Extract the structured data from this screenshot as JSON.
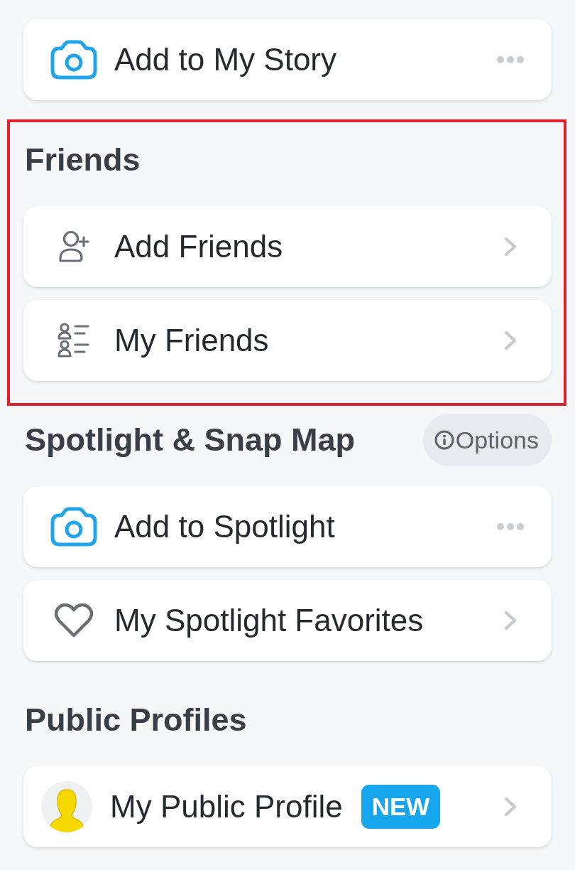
{
  "story_card": {
    "label": "Add to My Story",
    "kind": "camera"
  },
  "sections": [
    {
      "title": "Friends",
      "highlighted": true,
      "items": [
        {
          "label": "Add Friends",
          "kind": "add-person"
        },
        {
          "label": "My Friends",
          "kind": "people-list"
        }
      ]
    },
    {
      "title": "Spotlight & Snap Map",
      "highlighted": false,
      "options_button": {
        "label": "Options"
      },
      "items": [
        {
          "label": "Add to Spotlight",
          "kind": "camera"
        },
        {
          "label": "My Spotlight Favorites",
          "kind": "heart"
        }
      ]
    },
    {
      "title": "Public Profiles",
      "highlighted": false,
      "items": [
        {
          "label": "My Public Profile",
          "kind": "avatar",
          "badge": "NEW"
        }
      ]
    }
  ]
}
